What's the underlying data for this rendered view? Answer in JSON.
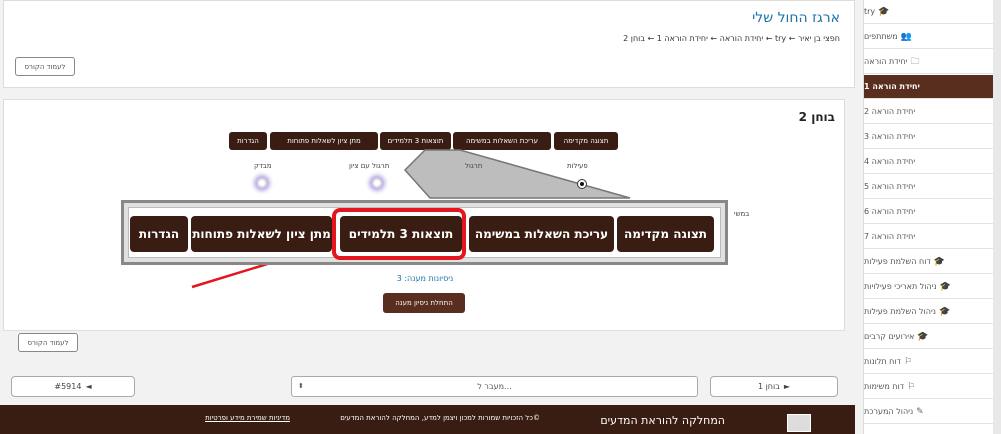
{
  "sidebar": {
    "items": [
      {
        "label": "try",
        "icon": "mortarboard-icon",
        "glyph": "🎓",
        "active": false
      },
      {
        "label": "משתתפים",
        "icon": "users-icon",
        "glyph": "👥",
        "active": false
      },
      {
        "label": "יחידת הוראה",
        "icon": "folder-icon",
        "glyph": "🗀",
        "active": false
      },
      {
        "label": "יחידת הוראה 1",
        "icon": "",
        "glyph": "",
        "active": true
      },
      {
        "label": "יחידת הוראה 2",
        "icon": "",
        "glyph": "",
        "active": false
      },
      {
        "label": "יחידת הוראה 3",
        "icon": "",
        "glyph": "",
        "active": false
      },
      {
        "label": "יחידת הוראה 4",
        "icon": "",
        "glyph": "",
        "active": false
      },
      {
        "label": "יחידת הוראה 5",
        "icon": "",
        "glyph": "",
        "active": false
      },
      {
        "label": "יחידת הוראה 6",
        "icon": "",
        "glyph": "",
        "active": false
      },
      {
        "label": "יחידת הוראה 7",
        "icon": "",
        "glyph": "",
        "active": false
      },
      {
        "label": "דוח השלמת פעילות",
        "icon": "mortarboard-icon",
        "glyph": "🎓",
        "active": false
      },
      {
        "label": "ניהול תאריכי פעילויות",
        "icon": "mortarboard-icon",
        "glyph": "🎓",
        "active": false
      },
      {
        "label": "ניהול השלמת פעילות",
        "icon": "mortarboard-icon",
        "glyph": "🎓",
        "active": false
      },
      {
        "label": "אירועים קרבים",
        "icon": "mortarboard-icon",
        "glyph": "🎓",
        "active": false
      },
      {
        "label": "דוח תלונות",
        "icon": "flag-icon",
        "glyph": "⚐",
        "active": false
      },
      {
        "label": "דוח משימות",
        "icon": "flag-icon",
        "glyph": "⚐",
        "active": false
      },
      {
        "label": "ניהול המערכת",
        "icon": "wrench-icon",
        "glyph": "✎",
        "active": false
      }
    ]
  },
  "header": {
    "course_title": "ארגז החול שלי",
    "breadcrumb": "חפצי בן יאיר ← try ← יחידת הוראה ← יחידת הוראה 1 ← בוחן 2",
    "to_course": "לעמוד הקורס"
  },
  "quiz": {
    "title": "בוחן 2",
    "nav": {
      "preview": "תצוגה מקדימה",
      "edit_questions": "עריכת השאלות במשימה",
      "results": "תוצאות 3 תלמידים",
      "grade_open": "מתן ציון לשאלות פתוחות",
      "settings": "הגדרות"
    },
    "radios": {
      "activity": "פעילות",
      "practice": "תרגול",
      "graded_practice": "תרגול עם ציון",
      "test": "מבדק"
    },
    "clipped_text": "במשי",
    "attempts_text": "ניסיונות מענה: 3",
    "start_attempt": "התחלת ניסיון מענה",
    "to_course_bottom": "לעמוד הקורס"
  },
  "pager": {
    "next": "בוחן 1",
    "next_arrow": "►",
    "prev": "#5914",
    "prev_arrow": "◄",
    "jump_placeholder": "מעבר ל...",
    "caret": "⬍"
  },
  "footer": {
    "org": "המחלקה להוראת המדעים",
    "rights": "©כל הזכויות שמורות למכון ויצמן למדע, המחלקה להוראת המדעים",
    "privacy": "מדיניות שמירת מידע ופרטיות"
  },
  "colors": {
    "brand_brown": "#3a1d12",
    "active_brown": "#5a2e1e",
    "link_blue": "#1a73a8",
    "highlight_red": "#e3161e"
  }
}
